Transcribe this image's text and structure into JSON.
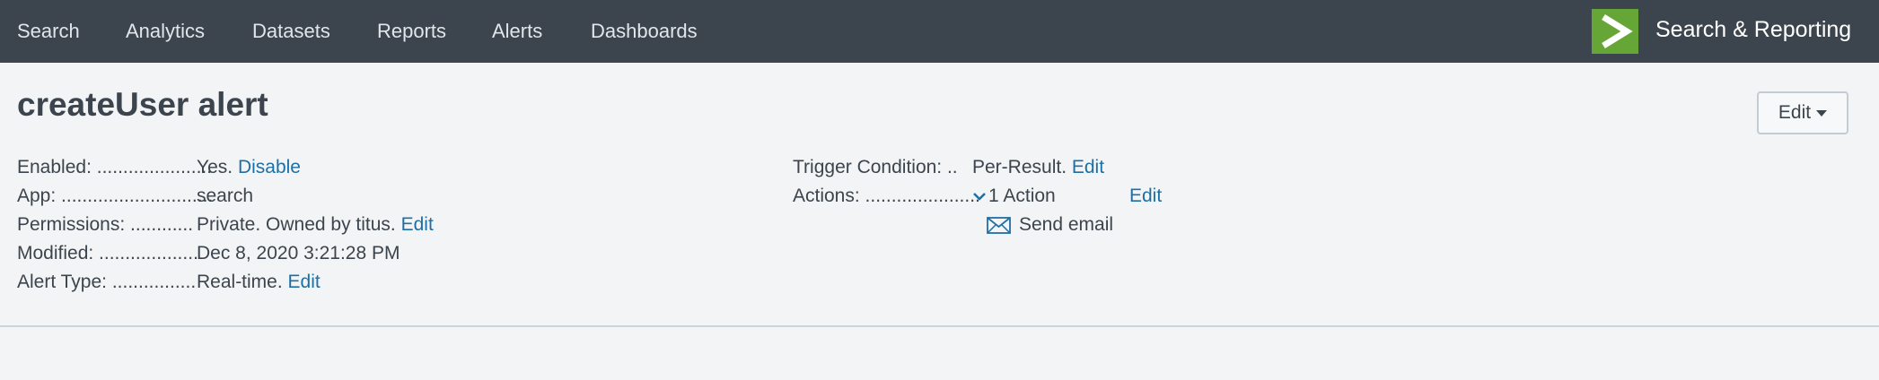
{
  "nav": {
    "items": [
      {
        "label": "Search"
      },
      {
        "label": "Analytics"
      },
      {
        "label": "Datasets"
      },
      {
        "label": "Reports"
      },
      {
        "label": "Alerts"
      },
      {
        "label": "Dashboards"
      }
    ],
    "app_name": "Search & Reporting",
    "logo_icon": "splunk-chevron-icon",
    "logo_color": "#65a637"
  },
  "page": {
    "title": "createUser alert",
    "edit_button": "Edit"
  },
  "details_left": {
    "enabled": {
      "label": "Enabled: ......................",
      "value": "Yes.",
      "link": "Disable"
    },
    "app": {
      "label": "App: .............................",
      "value": "search"
    },
    "permissions": {
      "label": "Permissions: ............",
      "value": "Private. Owned by titus.",
      "link": "Edit"
    },
    "modified": {
      "label": "Modified: ...................",
      "value": "Dec 8, 2020 3:21:28 PM"
    },
    "alert_type": {
      "label": "Alert Type: ................",
      "value": "Real-time.",
      "link": "Edit"
    }
  },
  "details_right": {
    "trigger": {
      "label": "Trigger Condition: ..",
      "value": "Per-Result.",
      "link": "Edit"
    },
    "actions": {
      "label": "Actions: ......................",
      "count": "1 Action",
      "link": "Edit",
      "items": [
        "Send email"
      ]
    }
  },
  "colors": {
    "topbar": "#3c444d",
    "link": "#1e6fa6",
    "background": "#f2f4f5"
  }
}
